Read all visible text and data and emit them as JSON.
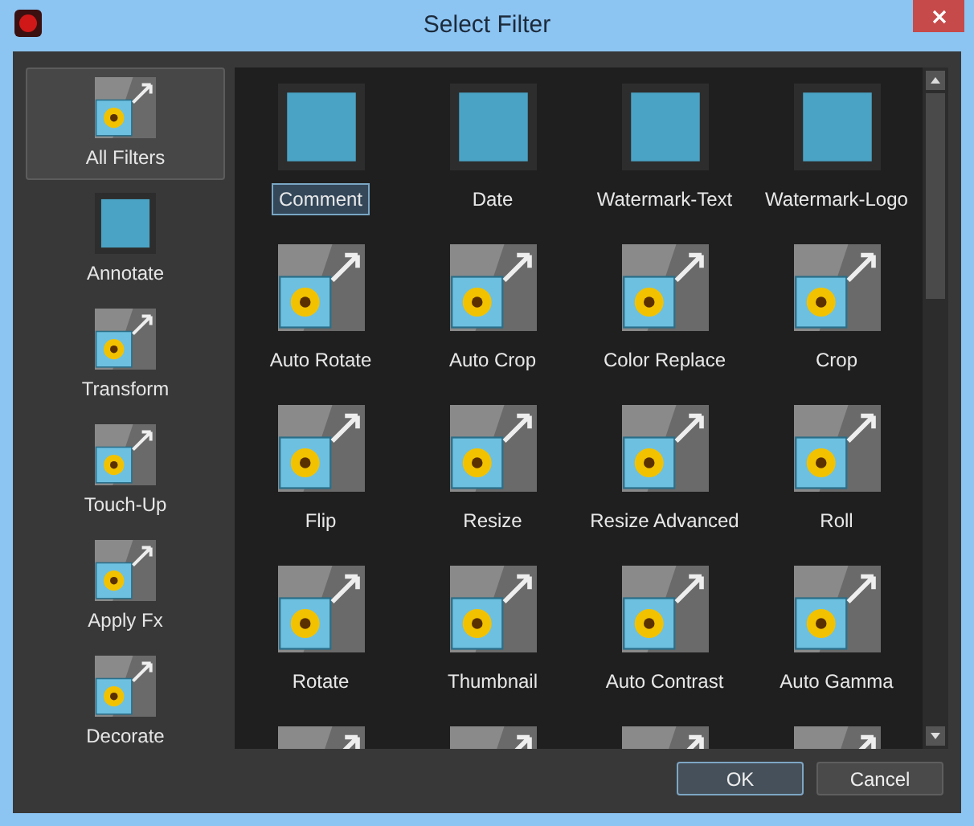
{
  "window": {
    "title": "Select Filter"
  },
  "categories": [
    {
      "label": "All Filters",
      "selected": true
    },
    {
      "label": "Annotate",
      "selected": false
    },
    {
      "label": "Transform",
      "selected": false
    },
    {
      "label": "Touch-Up",
      "selected": false
    },
    {
      "label": "Apply Fx",
      "selected": false
    },
    {
      "label": "Decorate",
      "selected": false
    }
  ],
  "filters": [
    {
      "kind": "full",
      "label": "Comment",
      "selected": true
    },
    {
      "kind": "full",
      "label": "Date",
      "selected": false
    },
    {
      "kind": "full",
      "label": "Watermark-Text",
      "selected": false
    },
    {
      "kind": "full",
      "label": "Watermark-Logo",
      "selected": false
    },
    {
      "kind": "full",
      "label": "Auto Rotate",
      "selected": false
    },
    {
      "kind": "full",
      "label": "Auto Crop",
      "selected": false
    },
    {
      "kind": "full",
      "label": "Color Replace",
      "selected": false
    },
    {
      "kind": "full",
      "label": "Crop",
      "selected": false
    },
    {
      "kind": "full",
      "label": "Flip",
      "selected": false
    },
    {
      "kind": "full",
      "label": "Resize",
      "selected": false
    },
    {
      "kind": "full",
      "label": "Resize Advanced",
      "selected": false
    },
    {
      "kind": "full",
      "label": "Roll",
      "selected": false
    },
    {
      "kind": "full",
      "label": "Rotate",
      "selected": false
    },
    {
      "kind": "full",
      "label": "Thumbnail",
      "selected": false
    },
    {
      "kind": "full",
      "label": "Auto Contrast",
      "selected": false
    },
    {
      "kind": "full",
      "label": "Auto Gamma",
      "selected": false
    },
    {
      "kind": "clipped"
    },
    {
      "kind": "clipped"
    },
    {
      "kind": "clipped"
    },
    {
      "kind": "clipped"
    }
  ],
  "buttons": [
    {
      "label": "OK",
      "selected": true
    },
    {
      "label": "Cancel",
      "selected": false
    }
  ]
}
